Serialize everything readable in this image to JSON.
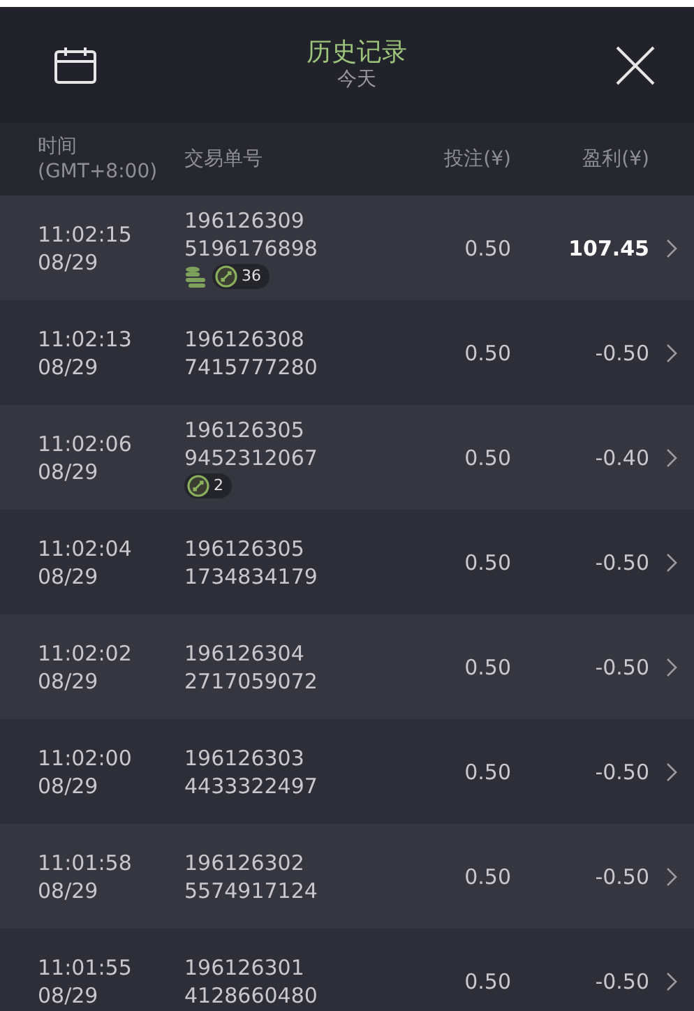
{
  "header": {
    "title": "历史记录",
    "subtitle": "今天"
  },
  "columns": [
    {
      "lines": [
        "时间",
        "(GMT+8:00)"
      ]
    },
    {
      "lines": [
        "交易单号"
      ]
    },
    {
      "lines": [
        "投注(¥)"
      ]
    },
    {
      "lines": [
        "盈利(¥)"
      ]
    }
  ],
  "rows": [
    {
      "time": "11:02:15",
      "date": "08/29",
      "id_1": "196126309",
      "id_2": "5196176898",
      "stake": "0.50",
      "profit": "107.45",
      "win": true,
      "coins": true,
      "spins": "36"
    },
    {
      "time": "11:02:13",
      "date": "08/29",
      "id_1": "196126308",
      "id_2": "7415777280",
      "stake": "0.50",
      "profit": "-0.50",
      "win": false,
      "coins": false
    },
    {
      "time": "11:02:06",
      "date": "08/29",
      "id_1": "196126305",
      "id_2": "9452312067",
      "stake": "0.50",
      "profit": "-0.40",
      "win": false,
      "coins": false,
      "spins": "2"
    },
    {
      "time": "11:02:04",
      "date": "08/29",
      "id_1": "196126305",
      "id_2": "1734834179",
      "stake": "0.50",
      "profit": "-0.50",
      "win": false,
      "coins": false
    },
    {
      "time": "11:02:02",
      "date": "08/29",
      "id_1": "196126304",
      "id_2": "2717059072",
      "stake": "0.50",
      "profit": "-0.50",
      "win": false,
      "coins": false
    },
    {
      "time": "11:02:00",
      "date": "08/29",
      "id_1": "196126303",
      "id_2": "4433322497",
      "stake": "0.50",
      "profit": "-0.50",
      "win": false,
      "coins": false
    },
    {
      "time": "11:01:58",
      "date": "08/29",
      "id_1": "196126302",
      "id_2": "5574917124",
      "stake": "0.50",
      "profit": "-0.50",
      "win": false,
      "coins": false
    },
    {
      "time": "11:01:55",
      "date": "08/29",
      "id_1": "196126301",
      "id_2": "4128660480",
      "stake": "0.50",
      "profit": "-0.50",
      "win": false,
      "coins": false
    }
  ]
}
